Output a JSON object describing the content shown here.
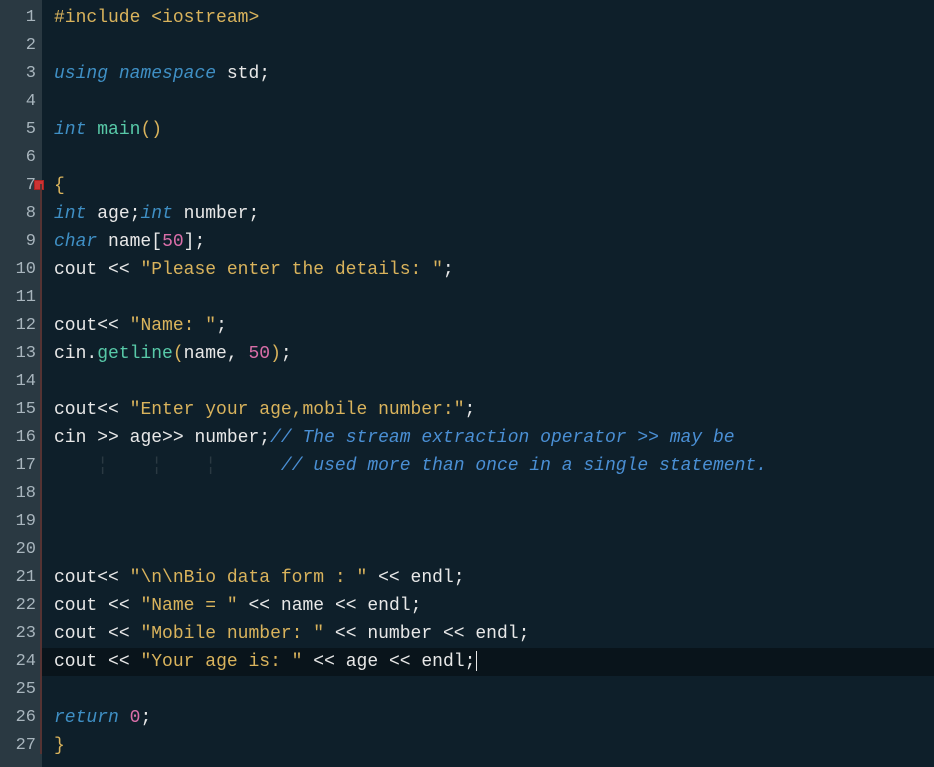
{
  "line_numbers": [
    "1",
    "2",
    "3",
    "4",
    "5",
    "6",
    "7",
    "8",
    "9",
    "10",
    "11",
    "12",
    "13",
    "14",
    "15",
    "16",
    "17",
    "18",
    "19",
    "20",
    "21",
    "22",
    "23",
    "24",
    "25",
    "26",
    "27"
  ],
  "code": {
    "l1": {
      "include": "#include",
      "header": "<iostream>"
    },
    "l3": {
      "using": "using",
      "namespace": "namespace",
      "std": "std",
      "semi": ";"
    },
    "l5": {
      "int": "int",
      "main": "main",
      "paren": "()"
    },
    "l7": {
      "brace": "{"
    },
    "l8": {
      "int1": "int",
      "age": "age",
      "semi1": ";",
      "int2": "int",
      "number": "number",
      "semi2": ";"
    },
    "l9": {
      "char": "char",
      "name": "name",
      "lbr": "[",
      "fifty": "50",
      "rbr": "]",
      "semi": ";"
    },
    "l10": {
      "cout": "cout",
      "op": "<<",
      "str": "\"Please enter the details: \"",
      "semi": ";"
    },
    "l12": {
      "cout": "cout",
      "op": "<<",
      "str": "\"Name: \"",
      "semi": ";"
    },
    "l13": {
      "cin": "cin",
      "dot": ".",
      "getline": "getline",
      "lp": "(",
      "name": "name",
      "comma": ",",
      "fifty": "50",
      "rp": ")",
      "semi": ";"
    },
    "l15": {
      "cout": "cout",
      "op": "<<",
      "str": "\"Enter your age,mobile number:\"",
      "semi": ";"
    },
    "l16": {
      "cin": "cin",
      "op1": ">>",
      "age": "age",
      "op2": ">>",
      "number": "number",
      "semi": ";",
      "comment": "// The stream extraction operator >> may be"
    },
    "l17": {
      "comment": "// used more than once in a single statement."
    },
    "l21": {
      "cout": "cout",
      "op1": "<<",
      "str": "\"\\n\\nBio data form : \"",
      "op2": "<<",
      "endl": "endl",
      "semi": ";"
    },
    "l22": {
      "cout": "cout",
      "op1": "<<",
      "str": "\"Name = \"",
      "op2": "<<",
      "name": "name",
      "op3": "<<",
      "endl": "endl",
      "semi": ";"
    },
    "l23": {
      "cout": "cout",
      "op1": "<<",
      "str": "\"Mobile number: \"",
      "op2": "<<",
      "number": "number",
      "op3": "<<",
      "endl": "endl",
      "semi": ";"
    },
    "l24": {
      "cout": "cout",
      "op1": "<<",
      "str": "\"Your age is: \"",
      "op2": "<<",
      "age": "age",
      "op3": "<<",
      "endl": "endl",
      "semi": ";"
    },
    "l26": {
      "return": "return",
      "zero": "0",
      "semi": ";"
    },
    "l27": {
      "brace": "}"
    }
  }
}
